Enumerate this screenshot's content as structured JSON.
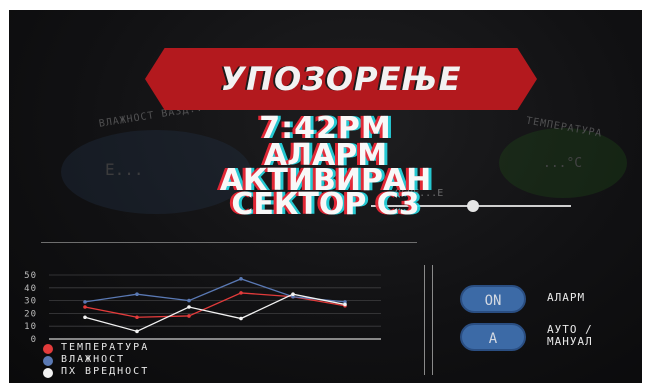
{
  "colors": {
    "banner": "#b3191e",
    "temperature": "#e23b3b",
    "humidity": "#5a79b4",
    "ph": "#f2f2f2",
    "button": "#3c6aa6"
  },
  "warning": {
    "title": "УПОЗОРЕЊЕ"
  },
  "alarm": {
    "time": "7:42PM",
    "line1": "АЛАРМ",
    "line2": "АКТИВИРАН",
    "line3": "СЕКТОР С3"
  },
  "background_dashboard": {
    "humidity_gauge_label": "ВЛАЖНОСТ ВАЗД...",
    "humidity_gauge_value": "Е...",
    "temperature_gauge_label": "ТЕМПЕРАТУРА",
    "temperature_gauge_value": "...°C",
    "slider_label": "...ОСВЕ...Е"
  },
  "chart_data": {
    "type": "line",
    "x": [
      1,
      2,
      3,
      4,
      5,
      6,
      7
    ],
    "y_ticks": [
      "0",
      "10",
      "20",
      "30",
      "40",
      "50"
    ],
    "ylim": [
      0,
      50
    ],
    "grid": true,
    "series": [
      {
        "name": "ТЕМПЕРАТУРА",
        "color": "#e23b3b",
        "values": [
          25,
          17,
          18,
          36,
          33,
          26
        ]
      },
      {
        "name": "ВЛАЖНОСТ",
        "color": "#5a79b4",
        "values": [
          29,
          35,
          30,
          47,
          33,
          29
        ]
      },
      {
        "name": "ПХ ВРЕДНОСТ",
        "color": "#f2f2f2",
        "values": [
          17,
          6,
          25,
          16,
          35,
          27
        ]
      }
    ]
  },
  "legend": {
    "temperature": "ТЕМПЕРАТУРА",
    "humidity": "ВЛАЖНОСТ",
    "ph": "ПХ ВРЕДНОСТ"
  },
  "controls": {
    "on_button": "ON",
    "alarm_label": "АЛАРМ",
    "mode_button": "A",
    "mode_label_1": "АУТО /",
    "mode_label_2": "МАНУАЛ"
  }
}
